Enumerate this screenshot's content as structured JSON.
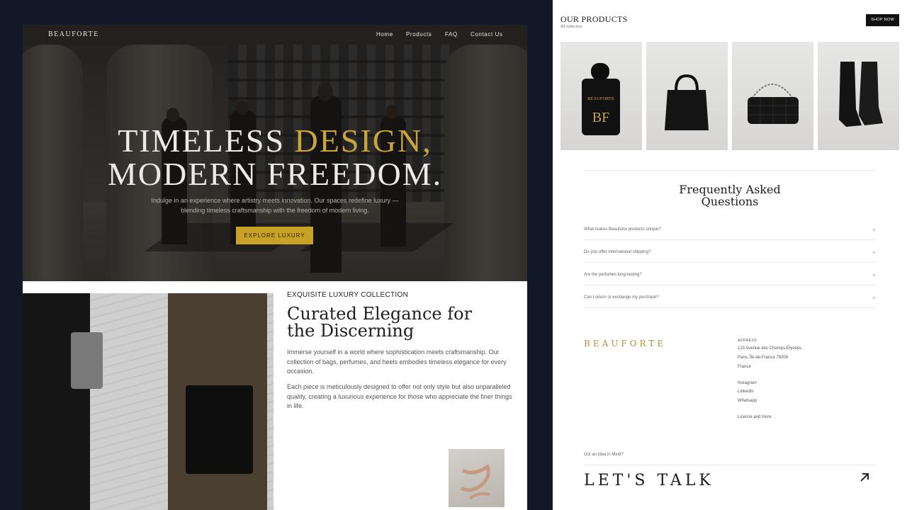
{
  "left": {
    "brand": "BEAUFORTE",
    "nav": [
      "Home",
      "Products",
      "FAQ",
      "Contact Us"
    ],
    "hero": {
      "line1_white": "TIMELESS ",
      "line1_gold": "DESIGN,",
      "line2": "MODERN FREEDOM.",
      "subtitle": "Indulge in an experience where artistry meets innovation. Our spaces redefine luxury — blending timeless craftsmanship with the freedom of modern living.",
      "cta": "EXPLORE LUXURY"
    },
    "story": {
      "label": "EXQUISITE LUXURY COLLECTION",
      "title": "Curated Elegance for the Discerning",
      "p1": "Immerse yourself in a world where sophistication meets craftsmanship. Our collection of bags, perfumes, and heels embodies timeless elegance for every occasion.",
      "p2": "Each piece is meticulously designed to offer not only style but also unparalleled quality, creating a luxurious experience for those who appreciate the finer things in life."
    }
  },
  "right": {
    "products_title": "OUR PRODUCTS",
    "products_sub": "All collection",
    "shop_now": "SHOP NOW",
    "perfume_label": "BEAUFORTE",
    "perfume_monogram": "BF",
    "faq_title_l1": "Frequently Asked",
    "faq_title_l2": "Questions",
    "faqs": [
      "What makes Beauforte products unique?",
      "Do you offer international shipping?",
      "Are the perfumes long-lasting?",
      "Can I return or exchange my purchase?"
    ],
    "faq_toggle": "+",
    "footer_brand": "BEAUFORTE",
    "address_label": "ADDRESS",
    "address_lines": [
      "123 Avenue des Champs-Élysées",
      "Paris, Île-de-France 75008",
      "France"
    ],
    "socials": [
      "Instagram",
      "LinkedIn",
      "Whatsapp"
    ],
    "license": "License and more",
    "idea": "Got an Idea in Mind?",
    "lets_talk": "LET'S TALK"
  },
  "colors": {
    "accent_gold": "#c9a225",
    "page_bg": "#111827"
  }
}
